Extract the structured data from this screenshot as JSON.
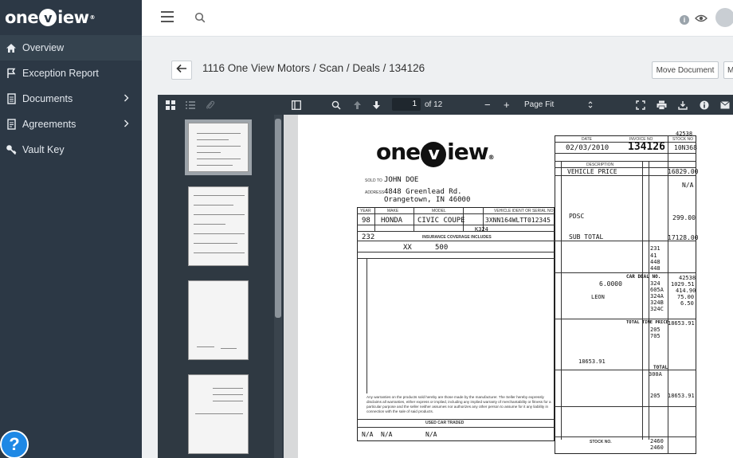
{
  "logo": {
    "part1": "one",
    "part2": "iew",
    "v": "v",
    "tm": "®"
  },
  "sidebar": {
    "items": [
      {
        "label": "Overview"
      },
      {
        "label": "Exception Report"
      },
      {
        "label": "Documents"
      },
      {
        "label": "Agreements"
      },
      {
        "label": "Vault Key"
      }
    ],
    "help": "?"
  },
  "topbar": {
    "info": "i"
  },
  "header": {
    "breadcrumb": "1116 One View Motors / Scan / Deals / 134126",
    "move_label": "Move Document",
    "more_label": "M"
  },
  "viewer": {
    "page": "1",
    "of_pages": "of 12",
    "zoom": "Page Fit",
    "minus": "−",
    "plus": "+"
  },
  "document": {
    "logo": {
      "part1": "one",
      "part2": "iew",
      "v": "v",
      "tm": "®"
    },
    "sold_to_label": "SOLD TO",
    "address_label": "ADDRESS",
    "buyer": "JOHN DOE",
    "address1": "4848 Greenlead Rd.",
    "address2": "Orangetown, IN 46000",
    "year_label": "YEAR",
    "make_label": "MAKE",
    "model_label": "MODEL",
    "vin_label": "VEHICLE IDENT OR SERIAL NO",
    "year": "98",
    "make": "HONDA",
    "model": "CIVIC COUPE",
    "vin": "3XNN164WLTT012345",
    "k324": "K324",
    "mileage": "232",
    "insurance_label": "INSURANCE COVERAGE INCLUDES",
    "collision": "XX",
    "deductible": "500",
    "date_label": "DATE",
    "invoice_label": "INVOICE NO",
    "stock_label": "STOCK NO",
    "date": "02/03/2010",
    "invoice": "134126",
    "stock": "10N368",
    "ref_no": "42538",
    "desc_label": "DESCRIPTION",
    "vehicle_price_label": "VEHICLE PRICE",
    "vehicle_price": "16829.00",
    "na1": "N/A",
    "pdsc_label": "PDSC",
    "pdsc": "299.00",
    "subtotal_label": "SUB TOTAL",
    "subtotal": "17128.00",
    "c231": "231",
    "c41": "41",
    "c448a": "448",
    "c448b": "448",
    "car_deal_label": "CAR DEAL NO.",
    "car_deal": "42538",
    "tax_rate": "6.0000",
    "c324": "324",
    "tax_amt": "1029.51",
    "c605a": "605A",
    "amt414": "414.90",
    "county": "LEON",
    "c324a": "324A",
    "amt75": "75.00",
    "c324b": "324B",
    "amt650": "6.50",
    "c324c": "324C",
    "total_time_price_label": "TOTAL TIME PRICE",
    "total_time_price": "18653.91",
    "c205": "205",
    "c705": "705",
    "amt_owed": "18653.91",
    "total_label": "TOTAL",
    "c300a": "300A",
    "c205b": "205",
    "total_final": "18653.91",
    "used_car_traded": "USED CAR TRADED",
    "trade_year": "N/A",
    "trade_make": "N/A",
    "trade_model": "N/A",
    "stock_no_label": "STOCK NO.",
    "c2460a": "2460",
    "c2460b": "2460",
    "disclaimer": "Any warranties on the products sold hereby are those made by the manufacturer. The Seller hereby expressly disclaims all warranties, either express or implied, including any implied warranty of merchantability or fitness for a particular purpose and the seller neither assumes nor authorizes any other person to assume for it any liability in connection with the sale of said products."
  }
}
